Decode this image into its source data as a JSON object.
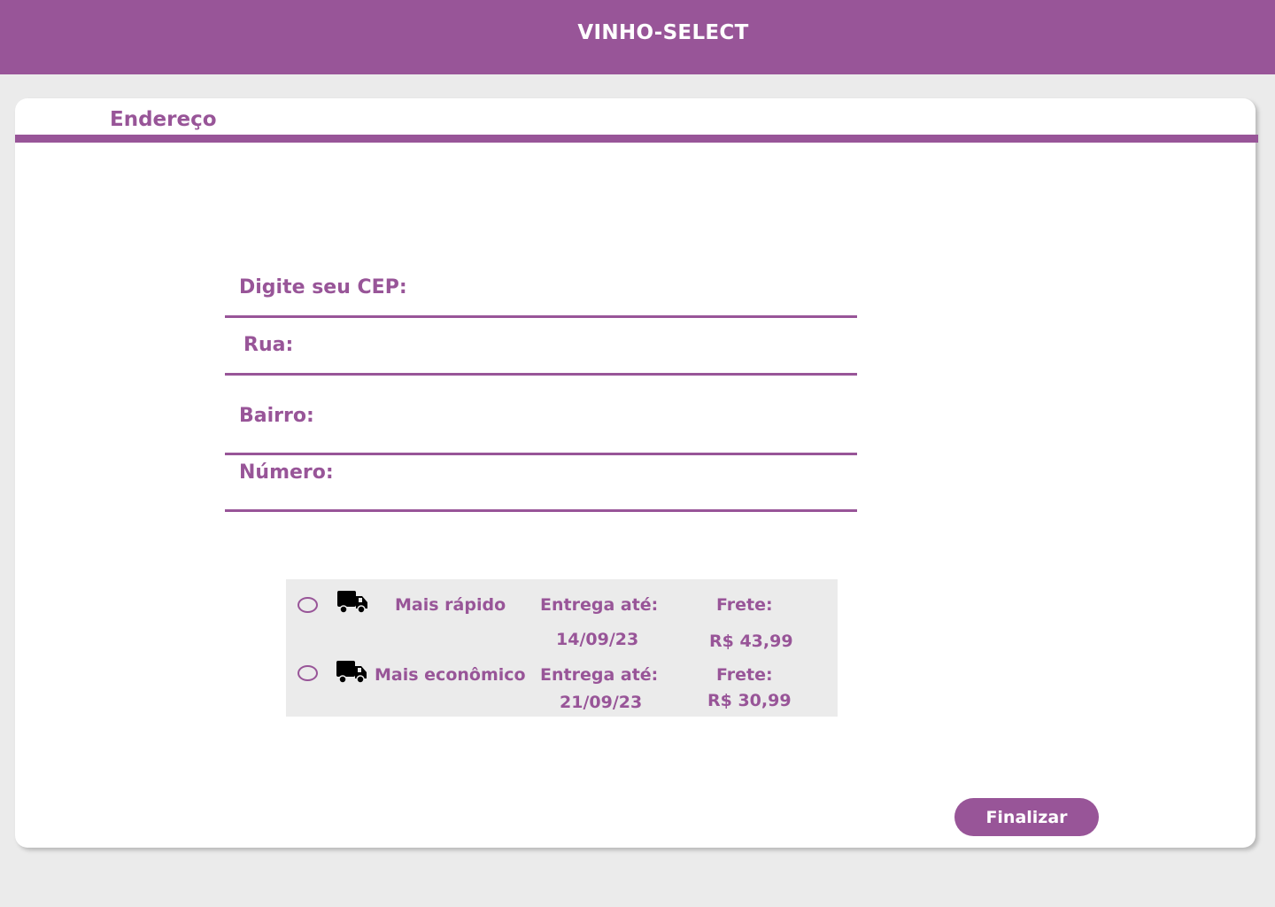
{
  "app": {
    "title": "VINHO-SELECT"
  },
  "section": {
    "title": "Endereço"
  },
  "form": {
    "cep_label": "Digite seu CEP:",
    "rua_label": "Rua:",
    "bairro_label": "Bairro:",
    "numero_label": "Número:",
    "cep_value": "",
    "rua_value": "",
    "bairro_value": "",
    "numero_value": ""
  },
  "shipping": {
    "options": [
      {
        "name": "Mais rápido",
        "delivery_label": "Entrega até:",
        "delivery_date": "14/09/23",
        "freight_label": "Frete:",
        "freight_value": "R$ 43,99",
        "icon": "truck-icon"
      },
      {
        "name": "Mais econômico",
        "delivery_label": "Entrega até:",
        "delivery_date": "21/09/23",
        "freight_label": "Frete:",
        "freight_value": "R$ 30,99",
        "icon": "truck-icon"
      }
    ]
  },
  "actions": {
    "finish_label": "Finalizar"
  },
  "colors": {
    "accent": "#985598",
    "background": "#ebebeb",
    "card": "#ffffff"
  }
}
